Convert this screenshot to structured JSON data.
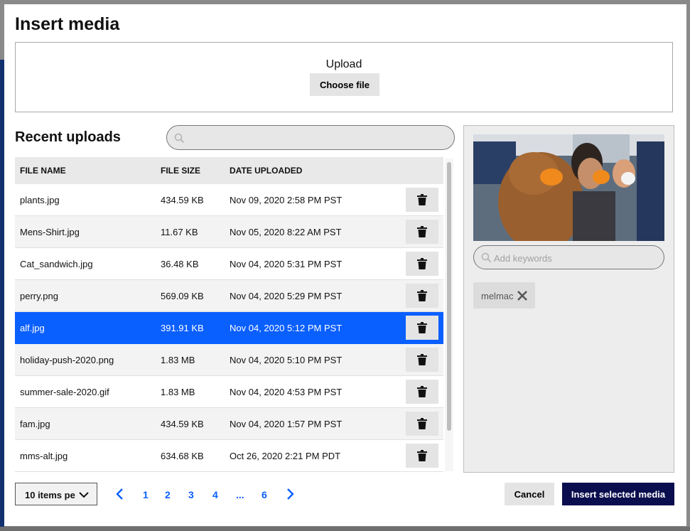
{
  "modal": {
    "title": "Insert media"
  },
  "upload": {
    "label": "Upload",
    "button": "Choose file"
  },
  "recent": {
    "title": "Recent uploads",
    "search_placeholder": ""
  },
  "table": {
    "columns": [
      "FILE NAME",
      "FILE SIZE",
      "DATE UPLOADED"
    ],
    "rows": [
      {
        "name": "plants.jpg",
        "size": "434.59 KB",
        "date": "Nov 09, 2020 2:58 PM PST"
      },
      {
        "name": "Mens-Shirt.jpg",
        "size": "11.67 KB",
        "date": "Nov 05, 2020 8:22 AM PST"
      },
      {
        "name": "Cat_sandwich.jpg",
        "size": "36.48 KB",
        "date": "Nov 04, 2020 5:31 PM PST"
      },
      {
        "name": "perry.png",
        "size": "569.09 KB",
        "date": "Nov 04, 2020 5:29 PM PST"
      },
      {
        "name": "alf.jpg",
        "size": "391.91 KB",
        "date": "Nov 04, 2020 5:12 PM PST"
      },
      {
        "name": "holiday-push-2020.png",
        "size": "1.83 MB",
        "date": "Nov 04, 2020 5:10 PM PST"
      },
      {
        "name": "summer-sale-2020.gif",
        "size": "1.83 MB",
        "date": "Nov 04, 2020 4:53 PM PST"
      },
      {
        "name": "fam.jpg",
        "size": "434.59 KB",
        "date": "Nov 04, 2020 1:57 PM PST"
      },
      {
        "name": "mms-alt.jpg",
        "size": "634.68 KB",
        "date": "Oct 26, 2020 2:21 PM PDT"
      }
    ],
    "selected_row": "alf.jpg",
    "delete_icon": "trash-icon"
  },
  "side_panel": {
    "keywords_placeholder": "Add keywords",
    "tags": [
      "melmac"
    ]
  },
  "footer": {
    "per_page": "10 items pe",
    "pages": [
      "1",
      "2",
      "3",
      "4",
      "...",
      "6"
    ],
    "cancel": "Cancel",
    "insert": "Insert selected media"
  },
  "colors": {
    "accent": "#0a5fff",
    "primary_button": "#0b0e4e"
  }
}
